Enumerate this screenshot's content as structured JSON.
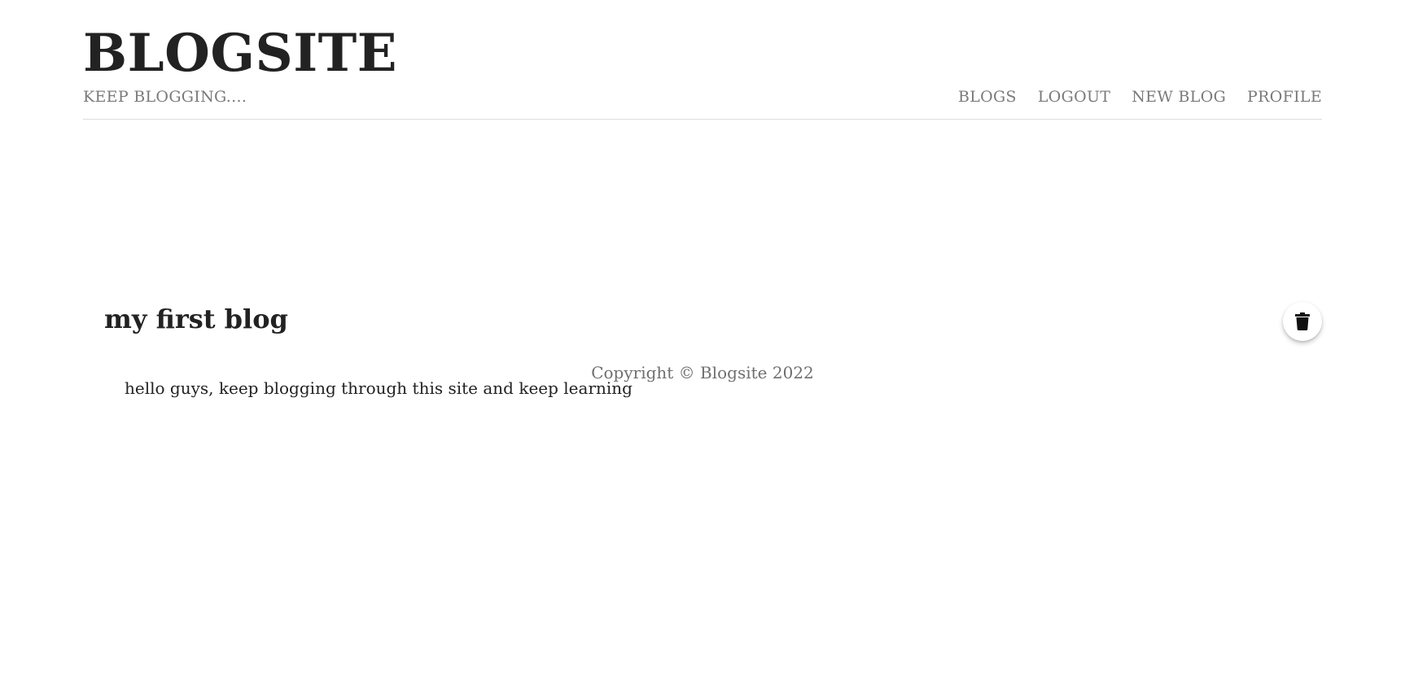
{
  "header": {
    "site_title": "BLOGSITE",
    "tagline": "KEEP BLOGGING....",
    "nav": [
      "BLOGS",
      "LOGOUT",
      "NEW BLOG",
      "PROFILE"
    ]
  },
  "post": {
    "title": "my first blog",
    "body": "hello guys, keep blogging through this site and keep learning",
    "delete_icon": "trash-icon"
  },
  "footer": {
    "copyright": "Copyright © Blogsite 2022"
  },
  "colors": {
    "text": "#222222",
    "muted": "#7a7a7a",
    "divider": "#dcdcdc"
  }
}
